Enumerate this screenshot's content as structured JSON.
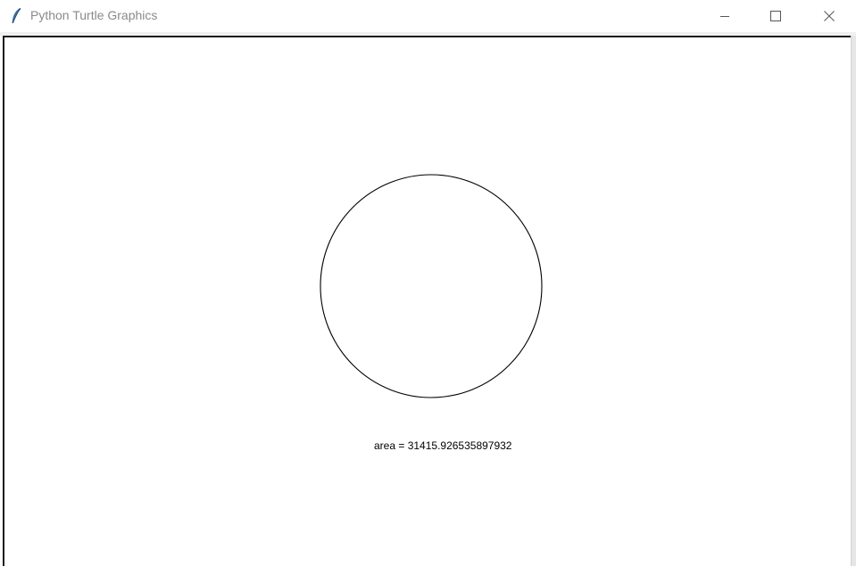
{
  "window": {
    "title": "Python Turtle Graphics",
    "app_icon": "feather-icon",
    "controls": {
      "minimize_icon": "minimize-icon",
      "maximize_icon": "maximize-icon",
      "close_icon": "close-icon"
    }
  },
  "canvas": {
    "background": "#ffffff",
    "drawing": {
      "shape": "circle",
      "stroke_color": "#000000"
    },
    "output_text": "area = 31415.926535897932"
  }
}
